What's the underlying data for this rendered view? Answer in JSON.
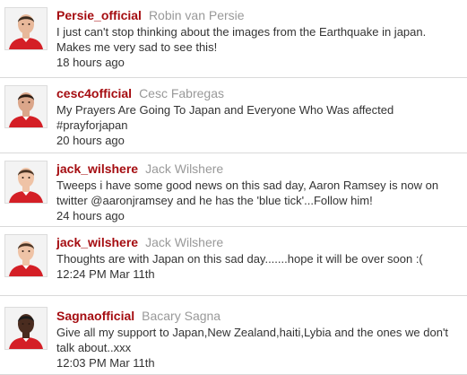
{
  "tweets": [
    {
      "screen_name": "Persie_official",
      "full_name": "Robin van Persie",
      "text": "I just can't stop thinking about the images from the Earthquake in japan. Makes me very sad to see this!",
      "time": "18 hours ago",
      "avatar": {
        "skin": "#e8b89a",
        "hair": "#3a2a1e",
        "shirt": "#d41f26"
      }
    },
    {
      "screen_name": "cesc4official",
      "full_name": "Cesc Fabregas",
      "text": "My Prayers Are Going To Japan and Everyone Who Was affected #prayforjapan",
      "time": "20 hours ago",
      "avatar": {
        "skin": "#dba68a",
        "hair": "#2b1d14",
        "shirt": "#d41f26"
      }
    },
    {
      "screen_name": "jack_wilshere",
      "full_name": "Jack Wilshere",
      "text": "Tweeps i have some good news on this sad day, Aaron Ramsey is now on twitter @aaronjramsey and he has the 'blue tick'...Follow him!",
      "time": "24 hours ago",
      "avatar": {
        "skin": "#efc3a6",
        "hair": "#4a3424",
        "shirt": "#d41f26"
      }
    },
    {
      "screen_name": "jack_wilshere",
      "full_name": "Jack Wilshere",
      "text": "Thoughts are with Japan on this sad day.......hope it will be over soon :(",
      "time": "12:24 PM Mar 11th",
      "avatar": {
        "skin": "#efc3a6",
        "hair": "#4a3424",
        "shirt": "#d41f26"
      }
    },
    {
      "screen_name": "Sagnaofficial",
      "full_name": "Bacary Sagna",
      "text": "Give all my support to Japan,New Zealand,haiti,Lybia and the ones we don't talk about..xxx",
      "time": "12:03 PM Mar 11th",
      "avatar": {
        "skin": "#4a2c1f",
        "hair": "#1a1a1a",
        "shirt": "#d41f26"
      }
    }
  ],
  "colors": {
    "screen_name": "#a50d11",
    "full_name": "#999999",
    "text": "#333333",
    "divider": "#d9d9d9"
  }
}
